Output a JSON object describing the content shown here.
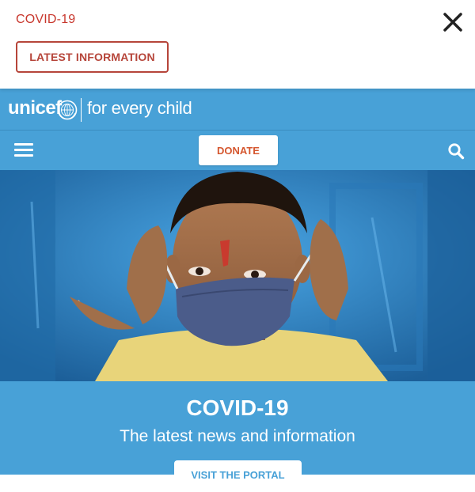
{
  "alert": {
    "title": "COVID-19",
    "button_label": "LATEST INFORMATION",
    "close_icon": "close-icon"
  },
  "header": {
    "brand": "unicef",
    "tagline": "for every child",
    "emblem_icon": "un-emblem-icon"
  },
  "nav": {
    "menu_icon": "hamburger-menu-icon",
    "donate_label": "DONATE",
    "search_icon": "search-icon"
  },
  "hero": {
    "image": "photo of a boy putting on a blue face mask against a blue wall"
  },
  "promo": {
    "title": "COVID-19",
    "subtitle": "The latest news and information",
    "button_label": "VISIT THE PORTAL"
  },
  "colors": {
    "brand_blue": "#48a1d7",
    "alert_red": "#c8372d",
    "donate_orange": "#d5572f"
  }
}
